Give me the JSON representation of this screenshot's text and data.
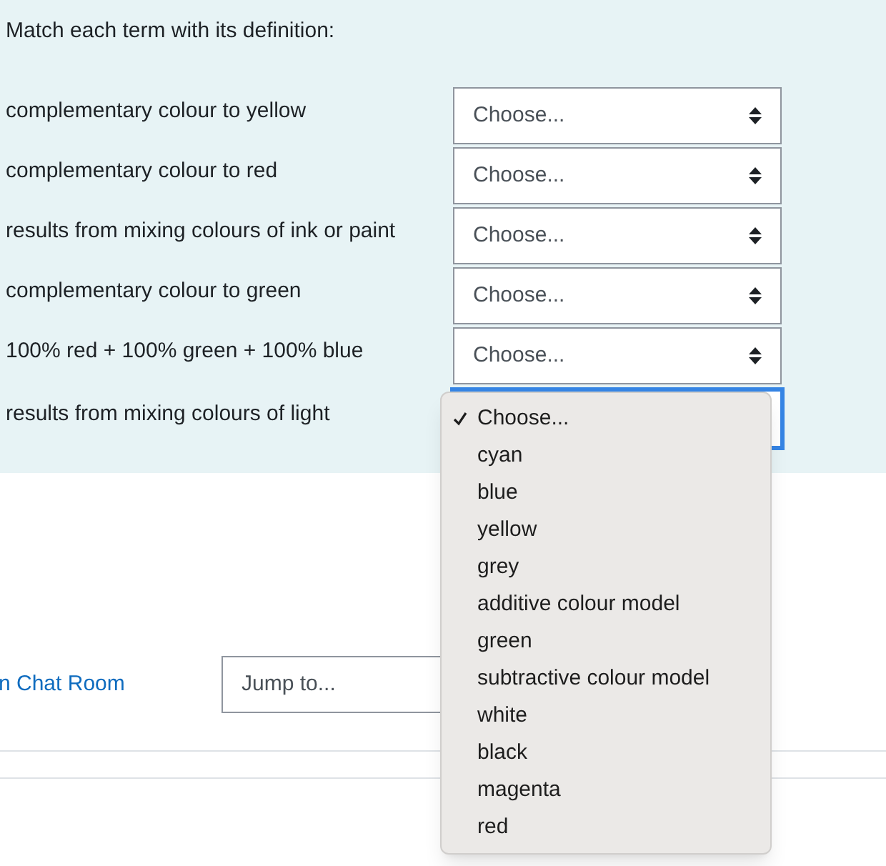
{
  "question": {
    "prompt": "Match each term with its definition:",
    "rows": [
      {
        "term": "complementary colour to yellow",
        "value": "Choose...",
        "focused": false
      },
      {
        "term": "complementary colour to red",
        "value": "Choose...",
        "focused": false
      },
      {
        "term": "results from mixing colours of ink or paint",
        "value": "Choose...",
        "focused": false
      },
      {
        "term": "complementary colour to green",
        "value": "Choose...",
        "focused": false
      },
      {
        "term": "100% red + 100% green + 100% blue",
        "value": "Choose...",
        "focused": false
      },
      {
        "term": "results from mixing colours of light",
        "focused": true
      }
    ]
  },
  "open_menu": {
    "options": [
      {
        "label": "Choose...",
        "selected": true
      },
      {
        "label": "cyan",
        "selected": false
      },
      {
        "label": "blue",
        "selected": false
      },
      {
        "label": "yellow",
        "selected": false
      },
      {
        "label": "grey",
        "selected": false
      },
      {
        "label": "additive colour model",
        "selected": false
      },
      {
        "label": "green",
        "selected": false
      },
      {
        "label": "subtractive colour model",
        "selected": false
      },
      {
        "label": "white",
        "selected": false
      },
      {
        "label": "black",
        "selected": false
      },
      {
        "label": "magenta",
        "selected": false
      },
      {
        "label": "red",
        "selected": false
      }
    ]
  },
  "footer": {
    "link": "n Chat Room",
    "jump_menu": {
      "value": "Jump to..."
    }
  }
}
